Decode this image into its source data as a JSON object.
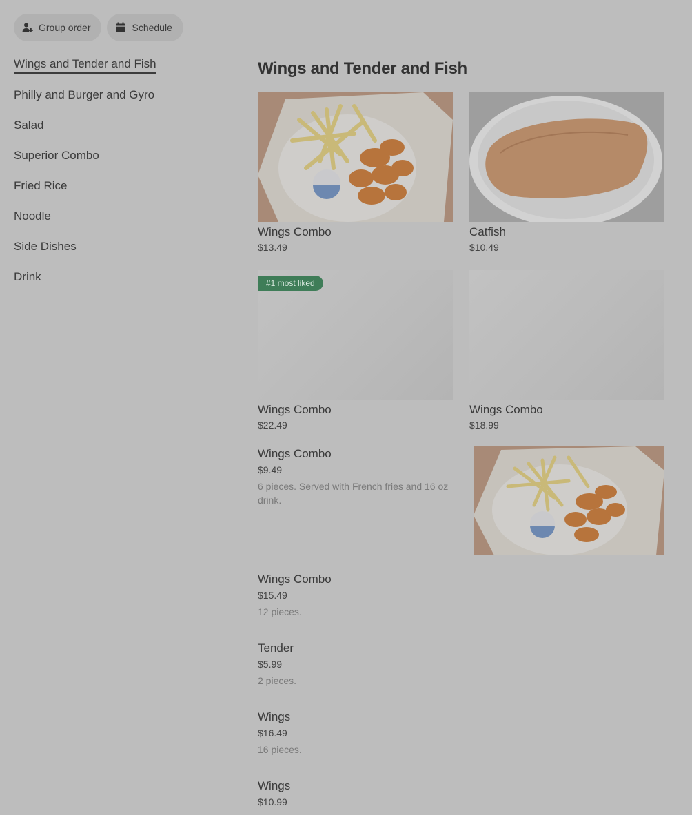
{
  "toolbar": {
    "group_order_label": "Group order",
    "schedule_label": "Schedule"
  },
  "sidebar": {
    "items": [
      {
        "label": "Wings and Tender and Fish"
      },
      {
        "label": "Philly and Burger and Gyro"
      },
      {
        "label": "Salad"
      },
      {
        "label": "Superior Combo"
      },
      {
        "label": "Fried Rice"
      },
      {
        "label": "Noodle"
      },
      {
        "label": "Side Dishes"
      },
      {
        "label": "Drink"
      }
    ]
  },
  "main": {
    "section_title": "Wings and Tender and Fish",
    "cards": [
      {
        "name": "Wings Combo",
        "price": "$13.49"
      },
      {
        "name": "Catfish",
        "price": "$10.49"
      },
      {
        "name": "Wings Combo",
        "price": "$22.49",
        "badge": "#1 most liked"
      },
      {
        "name": "Wings Combo",
        "price": "$18.99"
      }
    ],
    "list": [
      {
        "name": "Wings Combo",
        "price": "$9.49",
        "desc": "6 pieces. Served with French fries and 16 oz drink."
      },
      {
        "name": "Wings Combo",
        "price": "$15.49",
        "desc": "12 pieces."
      },
      {
        "name": "Tender",
        "price": "$5.99",
        "desc": "2 pieces."
      },
      {
        "name": "Wings",
        "price": "$16.49",
        "desc": "16 pieces."
      },
      {
        "name": "Wings",
        "price": "$10.99",
        "desc": ""
      }
    ]
  },
  "colors": {
    "overlay_bg": "#bdbdbd",
    "badge_green": "#3f7d58"
  }
}
